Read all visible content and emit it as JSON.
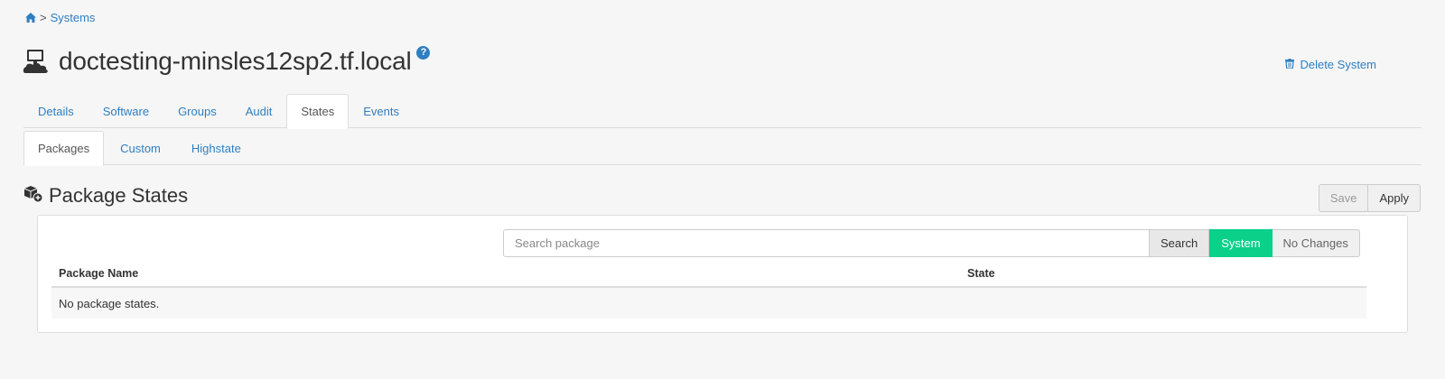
{
  "breadcrumb": {
    "home_icon": "home-icon",
    "separator": ">",
    "link": "Systems"
  },
  "header": {
    "title": "doctesting-minsles12sp2.tf.local",
    "help": "?",
    "delete_label": "Delete System"
  },
  "tabs": [
    {
      "label": "Details",
      "active": false
    },
    {
      "label": "Software",
      "active": false
    },
    {
      "label": "Groups",
      "active": false
    },
    {
      "label": "Audit",
      "active": false
    },
    {
      "label": "States",
      "active": true
    },
    {
      "label": "Events",
      "active": false
    }
  ],
  "subtabs": [
    {
      "label": "Packages",
      "active": true
    },
    {
      "label": "Custom",
      "active": false
    },
    {
      "label": "Highstate",
      "active": false
    }
  ],
  "section": {
    "title": "Package States",
    "save_label": "Save",
    "apply_label": "Apply"
  },
  "search": {
    "placeholder": "Search package",
    "search_label": "Search",
    "system_label": "System",
    "no_changes_label": "No Changes"
  },
  "table": {
    "columns": [
      "Package Name",
      "State"
    ],
    "empty_message": "No package states."
  },
  "colors": {
    "link": "#2e7fc1",
    "system_button": "#0ad08a",
    "background": "#f6f6f6"
  }
}
